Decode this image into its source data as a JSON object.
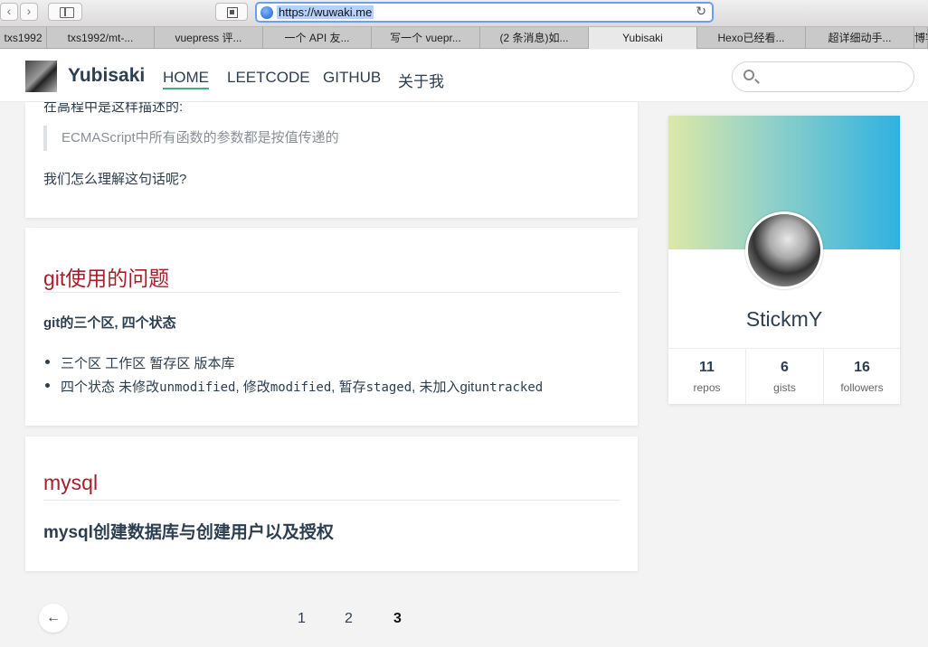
{
  "browser": {
    "url": "https://wuwaki.me",
    "tabs": [
      "txs1992",
      "txs1992/mt-...",
      "vuepress 评...",
      "一个 API 友...",
      "写一个 vuepr...",
      "(2 条消息)如...",
      "Yubisaki",
      "Hexo已经看...",
      "超详细动手...",
      "博客"
    ],
    "active_tab": 6
  },
  "site": {
    "name": "Yubisaki",
    "nav": [
      "HOME",
      "LEETCODE",
      "GITHUB",
      "关于我"
    ],
    "active_nav": "HOME",
    "search_placeholder": ""
  },
  "posts": {
    "first": {
      "cut_text": "在高程中是这样描述的:",
      "quote": "ECMAScript中所有函数的参数都是按值传递的",
      "paragraph": "我们怎么理解这句话呢?"
    },
    "git": {
      "title": "git使用的问题",
      "subheading": "git的三个区, 四个状态",
      "item1": "三个区 工作区 暂存区 版本库",
      "item2_a": "四个状态 未修改",
      "item2_b": "unmodified",
      "item2_c": ", 修改",
      "item2_d": "modified",
      "item2_e": ", 暂存",
      "item2_f": "staged",
      "item2_g": ", 未加入git",
      "item2_h": "untracked"
    },
    "mysql": {
      "title": "mysql",
      "subheading": "mysql创建数据库与创建用户以及授权"
    }
  },
  "profile": {
    "name": "StickmY",
    "stats": [
      {
        "num": "11",
        "label": "repos"
      },
      {
        "num": "6",
        "label": "gists"
      },
      {
        "num": "16",
        "label": "followers"
      }
    ]
  },
  "pagination": {
    "prev": "←",
    "pages": [
      "1",
      "2",
      "3"
    ],
    "current": "3"
  }
}
